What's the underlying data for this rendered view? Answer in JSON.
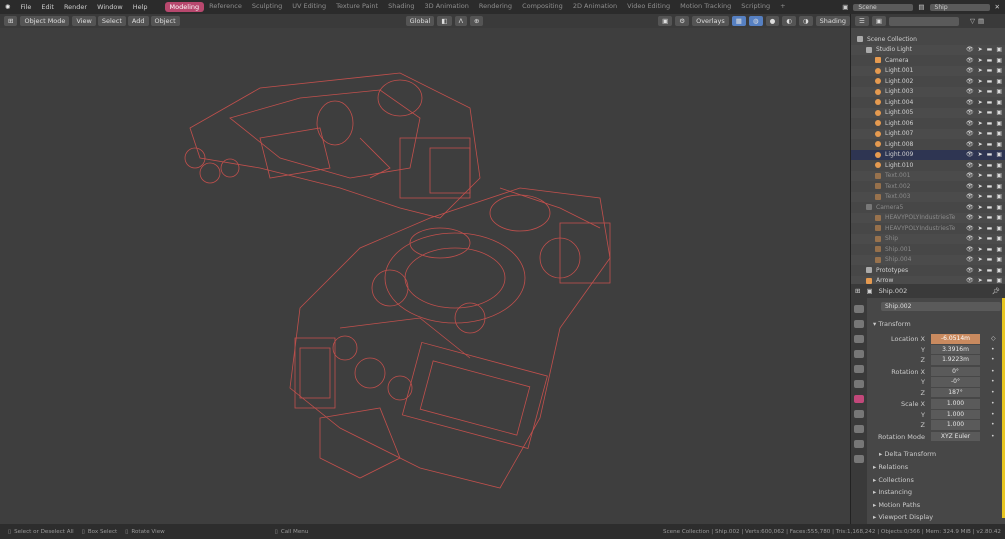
{
  "menu": {
    "items": [
      "File",
      "Edit",
      "Render",
      "Window",
      "Help"
    ],
    "workspaces": [
      "Modeling",
      "Reference",
      "Sculpting",
      "UV Editing",
      "Texture Paint",
      "Shading",
      "3D Animation",
      "Rendering",
      "Compositing",
      "2D Animation",
      "Video Editing",
      "Motion Tracking",
      "Scripting",
      "+"
    ],
    "active_workspace": "Modeling",
    "scene": "Scene",
    "view_layer": "Ship"
  },
  "header": {
    "mode": "Object Mode",
    "menus": [
      "View",
      "Select",
      "Add",
      "Object"
    ],
    "orientation": "Global",
    "overlays": "Overlays",
    "shading": "Shading"
  },
  "outliner": {
    "search_placeholder": "",
    "items": [
      {
        "name": "Scene Collection",
        "level": 0,
        "type": "scene"
      },
      {
        "name": "Studio Light",
        "level": 1,
        "type": "collection"
      },
      {
        "name": "Camera",
        "level": 2,
        "type": "camera"
      },
      {
        "name": "Light.001",
        "level": 2,
        "type": "light"
      },
      {
        "name": "Light.002",
        "level": 2,
        "type": "light"
      },
      {
        "name": "Light.003",
        "level": 2,
        "type": "light"
      },
      {
        "name": "Light.004",
        "level": 2,
        "type": "light"
      },
      {
        "name": "Light.005",
        "level": 2,
        "type": "light"
      },
      {
        "name": "Light.006",
        "level": 2,
        "type": "light"
      },
      {
        "name": "Light.007",
        "level": 2,
        "type": "light"
      },
      {
        "name": "Light.008",
        "level": 2,
        "type": "light"
      },
      {
        "name": "Light.009",
        "level": 2,
        "type": "light",
        "selected": true
      },
      {
        "name": "Light.010",
        "level": 2,
        "type": "light"
      },
      {
        "name": "Text.001",
        "level": 2,
        "type": "text",
        "dim": true
      },
      {
        "name": "Text.002",
        "level": 2,
        "type": "text",
        "dim": true
      },
      {
        "name": "Text.003",
        "level": 2,
        "type": "text",
        "dim": true
      },
      {
        "name": "Camera5",
        "level": 1,
        "type": "collection",
        "dim": true
      },
      {
        "name": "HEAVYPOLYIndustriesTe",
        "level": 2,
        "type": "mesh",
        "dim": true
      },
      {
        "name": "HEAVYPOLYIndustriesTe",
        "level": 2,
        "type": "mesh",
        "dim": true
      },
      {
        "name": "Ship",
        "level": 2,
        "type": "mesh",
        "dim": true
      },
      {
        "name": "Ship.001",
        "level": 2,
        "type": "mesh",
        "dim": true
      },
      {
        "name": "Ship.004",
        "level": 2,
        "type": "mesh",
        "dim": true
      },
      {
        "name": "Prototypes",
        "level": 1,
        "type": "collection"
      },
      {
        "name": "Arrow",
        "level": 1,
        "type": "armature"
      }
    ]
  },
  "properties": {
    "context": "Ship.002",
    "object_name": "Ship.002",
    "panel": "Transform",
    "fields": [
      {
        "label": "Location X",
        "value": "-6.0514m",
        "hot": true
      },
      {
        "label": "Y",
        "value": "3.3916m"
      },
      {
        "label": "Z",
        "value": "1.9223m"
      },
      {
        "label": "Rotation X",
        "value": "0°"
      },
      {
        "label": "Y",
        "value": "-0°"
      },
      {
        "label": "Z",
        "value": "187°"
      },
      {
        "label": "Scale X",
        "value": "1.000"
      },
      {
        "label": "Y",
        "value": "1.000"
      },
      {
        "label": "Z",
        "value": "1.000"
      },
      {
        "label": "Rotation Mode",
        "value": "XYZ Euler"
      }
    ],
    "subpanels": [
      "Delta Transform"
    ],
    "sections": [
      "Relations",
      "Collections",
      "Instancing",
      "Motion Paths",
      "Viewport Display"
    ]
  },
  "status": {
    "hints": [
      "Select or Deselect All",
      "Box Select",
      "Rotate View",
      "Call Menu"
    ],
    "info": "Scene Collection | Ship.002 | Verts:600,062 | Faces:555,780 | Tris:1,168,242 | Objects:0/366 | Mem: 324.9 MiB | v2.80.42"
  },
  "colors": {
    "wireframe": "#d9534f",
    "accent": "#b8486e",
    "selected_row": "#2e3552",
    "active_field": "#c98a5f"
  }
}
